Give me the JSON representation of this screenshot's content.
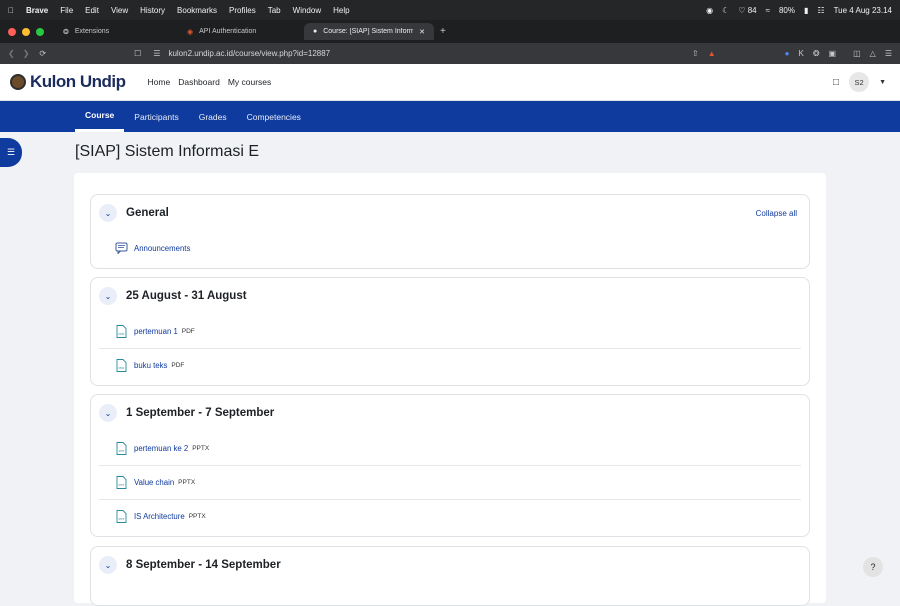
{
  "menubar": {
    "app": "Brave",
    "items": [
      "File",
      "Edit",
      "View",
      "History",
      "Bookmarks",
      "Profiles",
      "Tab",
      "Window",
      "Help"
    ],
    "battery_status": "84",
    "battery_pct": "80%",
    "clock": "Tue 4 Aug  23.14"
  },
  "tabs": [
    {
      "title": "Extensions"
    },
    {
      "title": "API Authentication"
    },
    {
      "title": "Course: [SIAP] Sistem Informasi E"
    }
  ],
  "toolbar": {
    "url": "kulon2.undip.ac.id/course/view.php?id=12887"
  },
  "site": {
    "logo": "Kulon Undip",
    "nav": [
      "Home",
      "Dashboard",
      "My courses"
    ],
    "avatar": "S2"
  },
  "course_nav": [
    "Course",
    "Participants",
    "Grades",
    "Competencies"
  ],
  "page": {
    "title": "[SIAP] Sistem Informasi E"
  },
  "collapse_all": "Collapse all",
  "sections": [
    {
      "title": "General",
      "activities": [
        {
          "name": "Announcements",
          "type": ""
        }
      ]
    },
    {
      "title": "25 August - 31 August",
      "activities": [
        {
          "name": "pertemuan 1",
          "type": "PDF"
        },
        {
          "name": "buku teks",
          "type": "PDF"
        }
      ]
    },
    {
      "title": "1 September - 7 September",
      "activities": [
        {
          "name": "pertemuan ke 2",
          "type": "PPTX"
        },
        {
          "name": "Value chain",
          "type": "PPTX"
        },
        {
          "name": "IS Architecture",
          "type": "PPTX"
        }
      ]
    },
    {
      "title": "8 September - 14 September",
      "activities": []
    }
  ],
  "help": "?",
  "colors": {
    "brand": "#0f3a9e",
    "link": "#0f3a9e"
  }
}
